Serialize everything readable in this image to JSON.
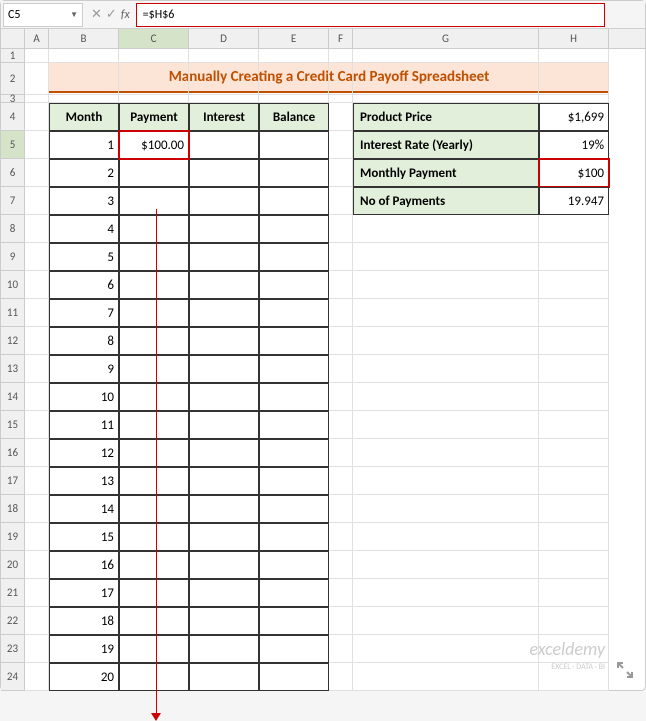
{
  "name_box": "C5",
  "formula": "=$H$6",
  "columns": [
    "A",
    "B",
    "C",
    "D",
    "E",
    "F",
    "G",
    "H"
  ],
  "title": "Manually Creating a Credit Card Payoff Spreadsheet",
  "main_headers": [
    "Month",
    "Payment",
    "Interest",
    "Balance"
  ],
  "payment_value": "$100.00",
  "months": [
    "1",
    "2",
    "3",
    "4",
    "5",
    "6",
    "7",
    "8",
    "9",
    "10",
    "11",
    "12",
    "13",
    "14",
    "15",
    "16",
    "17",
    "18",
    "19",
    "20"
  ],
  "row_nums": [
    "1",
    "2",
    "3",
    "4",
    "5",
    "6",
    "7",
    "8",
    "9",
    "10",
    "11",
    "12",
    "13",
    "14",
    "15",
    "16",
    "17",
    "18",
    "19",
    "20",
    "21",
    "22",
    "23",
    "24"
  ],
  "side": [
    {
      "label": "Product Price",
      "value": "$1,699"
    },
    {
      "label": "Interest Rate (Yearly)",
      "value": "19%"
    },
    {
      "label": "Monthly Payment",
      "value": "$100"
    },
    {
      "label": "No of Payments",
      "value": "19.947"
    }
  ],
  "watermark": "exceldemy",
  "watermark_sub": "EXCEL · DATA · BI"
}
